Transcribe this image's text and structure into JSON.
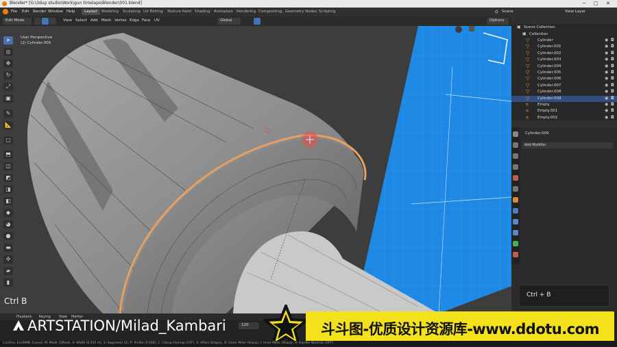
{
  "titlebar": {
    "title": "Blender* [G:\\3dup studio\\Work\\gun timelaps\\Blender\\001.blend]"
  },
  "menubar": {
    "menus": [
      "File",
      "Edit",
      "Render",
      "Window",
      "Help"
    ],
    "workspaces": [
      "Layout",
      "Modeling",
      "Sculpting",
      "UV Editing",
      "Texture Paint",
      "Shading",
      "Animation",
      "Rendering",
      "Compositing",
      "Geometry Nodes",
      "Scripting"
    ],
    "active_workspace": "Layout",
    "scene_label": "Scene",
    "view_layer_label": "View Layer"
  },
  "header": {
    "mode": "Edit Mode",
    "menus": [
      "View",
      "Select",
      "Add",
      "Mesh",
      "Vertex",
      "Edge",
      "Face",
      "UV"
    ],
    "transform_orientation": "Global",
    "options_label": "Options"
  },
  "viewport": {
    "perspective_label": "User Perspective",
    "object_label": "(2) Cylinder.009",
    "key_hint": "Ctrl B",
    "colors": {
      "background": "#3d3d3d",
      "mesh": "#8c8c8c",
      "selected_edge": "#e8a060",
      "blueprint": "#1e88e5"
    }
  },
  "outliner": {
    "header": "Scene Collection",
    "collection": "Collection",
    "items": [
      "Cylinder",
      "Cylinder.001",
      "Cylinder.002",
      "Cylinder.003",
      "Cylinder.004",
      "Cylinder.005",
      "Cylinder.006",
      "Cylinder.007",
      "Cylinder.008",
      "Cylinder.009",
      "Empty",
      "Empty.001",
      "Empty.002"
    ],
    "selected": "Cylinder.009"
  },
  "properties": {
    "object_name": "Cylinder.009",
    "add_modifier_label": "Add Modifier"
  },
  "key_overlay": {
    "text": "Ctrl + B"
  },
  "timeline": {
    "menus": [
      "Playback",
      "Keying",
      "View",
      "Marker"
    ],
    "frame": "120"
  },
  "statusbar": {
    "text": "Confirm, Esc/RMB: Cancel, M: Mode (Offset), A: Width (0.015 m), S: Segments (2), P: Profile (0.500), C: Clamp Overlap (OFF), V: Affect (Edges), O: Outer Miter (Sharp), I: Inner Miter (Sharp), H: Harden Normals (OFF)"
  },
  "watermarks": {
    "artstation": "ARTSTATION/Milad_Kambari",
    "site": "斗斗图-优质设计资源库-www.ddotu.com"
  }
}
